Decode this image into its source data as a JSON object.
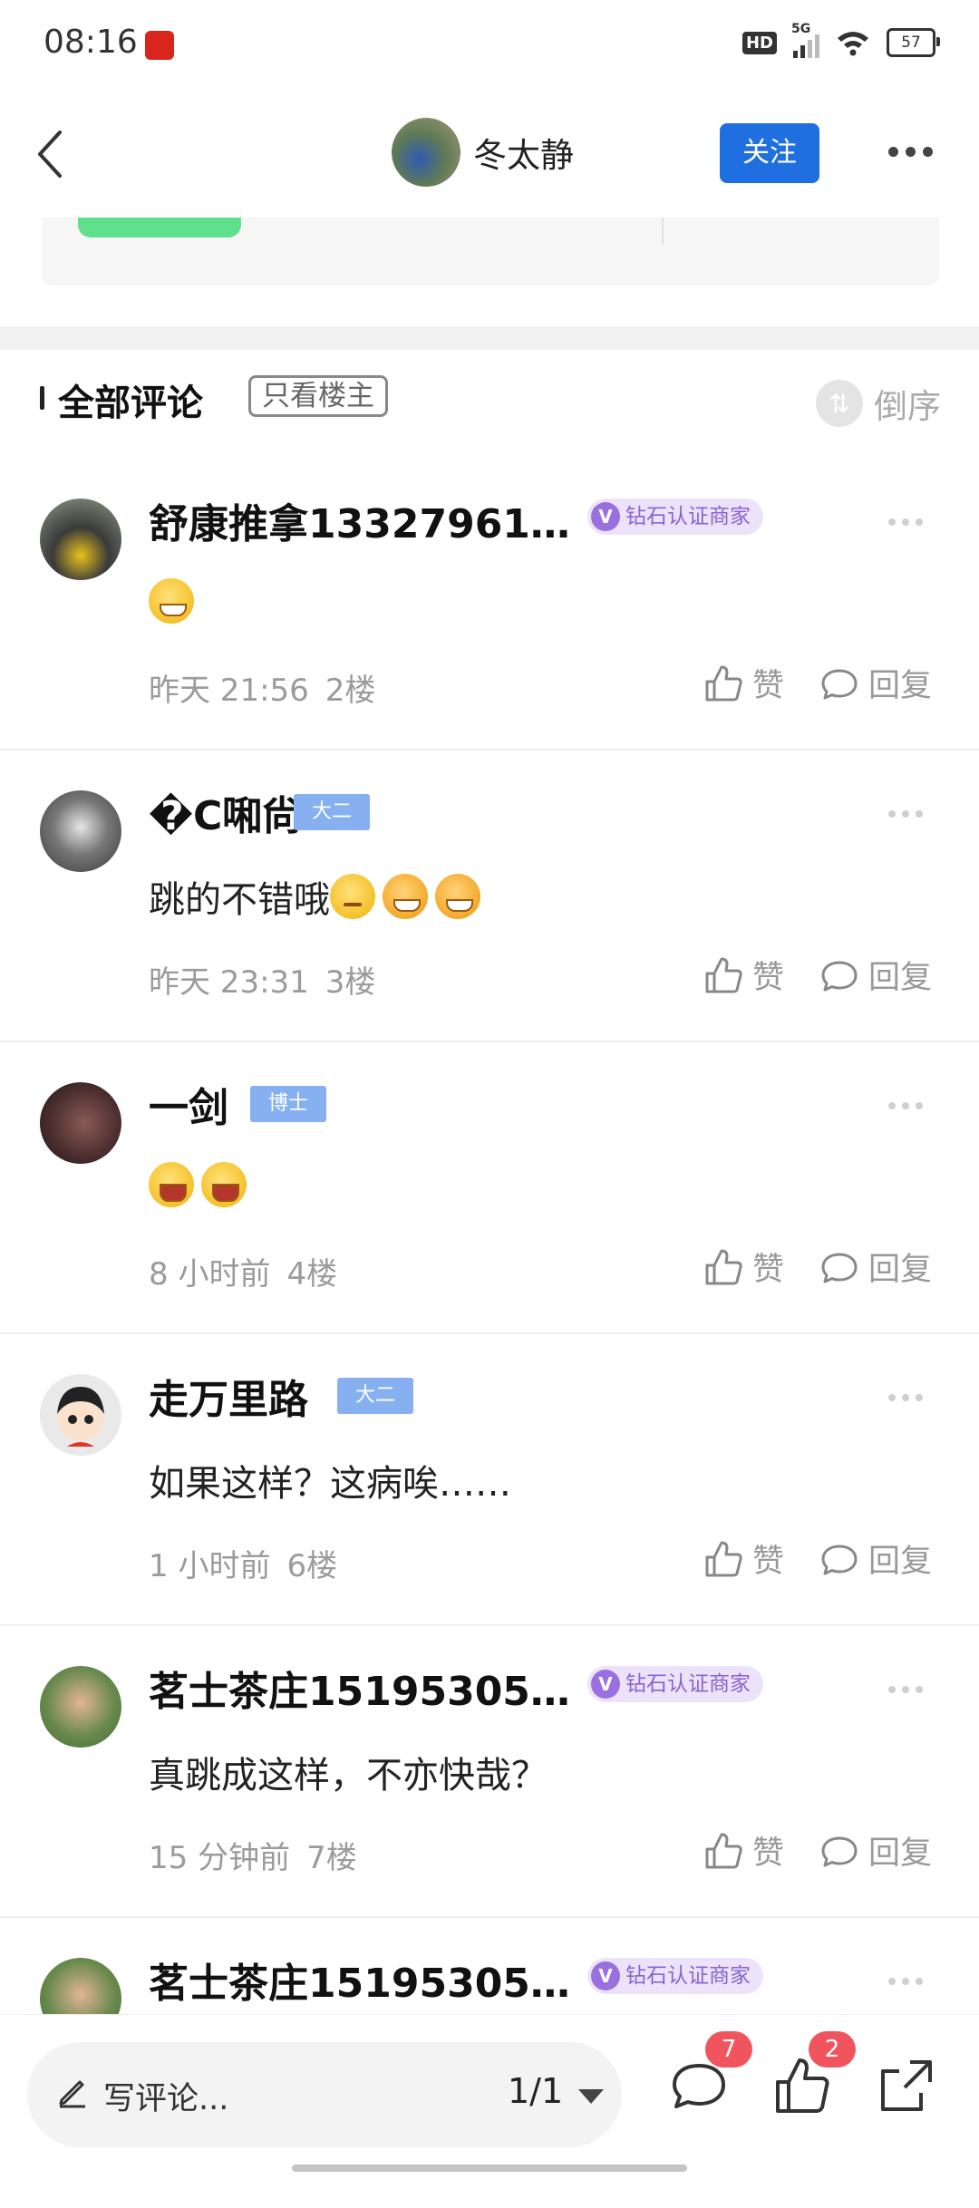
{
  "status_bar": {
    "time": "08:16",
    "hd": "HD",
    "network": "5G",
    "battery": "57"
  },
  "header": {
    "author_name": "冬太静",
    "follow_label": "关注"
  },
  "comments_header": {
    "title": "全部评论",
    "only_op_label": "只看楼主",
    "sort_label": "倒序"
  },
  "comments": [
    {
      "user": "舒康推拿13327961…",
      "badge": "钻石认证商家",
      "badge_type": "merchant",
      "text": "",
      "emojis": [
        "grin"
      ],
      "time": "昨天 21:56",
      "floor": "2楼",
      "like_label": "赞",
      "reply_label": "回复"
    },
    {
      "user": "�C啝尙",
      "badge": "大二",
      "badge_type": "grade",
      "text": "跳的不错哦",
      "emojis": [
        "smirk",
        "blush",
        "blush"
      ],
      "time": "昨天 23:31",
      "floor": "3楼",
      "like_label": "赞",
      "reply_label": "回复"
    },
    {
      "user": "一剑",
      "badge": "博士",
      "badge_type": "grade",
      "text": "",
      "emojis": [
        "laugh",
        "laugh"
      ],
      "time": "8 小时前",
      "floor": "4楼",
      "like_label": "赞",
      "reply_label": "回复"
    },
    {
      "user": "走万里路",
      "badge": "大二",
      "badge_type": "grade",
      "text": "如果这样？这病唉……",
      "emojis": [],
      "time": "1 小时前",
      "floor": "6楼",
      "like_label": "赞",
      "reply_label": "回复"
    },
    {
      "user": "茗士茶庄15195305…",
      "badge": "钻石认证商家",
      "badge_type": "merchant",
      "text": "真跳成这样，不亦快哉？",
      "emojis": [],
      "time": "15 分钟前",
      "floor": "7楼",
      "like_label": "赞",
      "reply_label": "回复"
    },
    {
      "user": "茗士茶庄15195305…",
      "badge": "钻石认证商家",
      "badge_type": "merchant",
      "text": "",
      "emojis": [],
      "time": "",
      "floor": "",
      "like_label": "",
      "reply_label": ""
    }
  ],
  "bottom_bar": {
    "composer_placeholder": "写评论...",
    "page_indicator": "1/1",
    "comment_count": "7",
    "like_count": "2"
  },
  "colors": {
    "accent_blue": "#1f6fe0",
    "merchant_badge": "#9a6fe0",
    "grade_badge": "#86b0ef",
    "count_red": "#f0555e"
  }
}
